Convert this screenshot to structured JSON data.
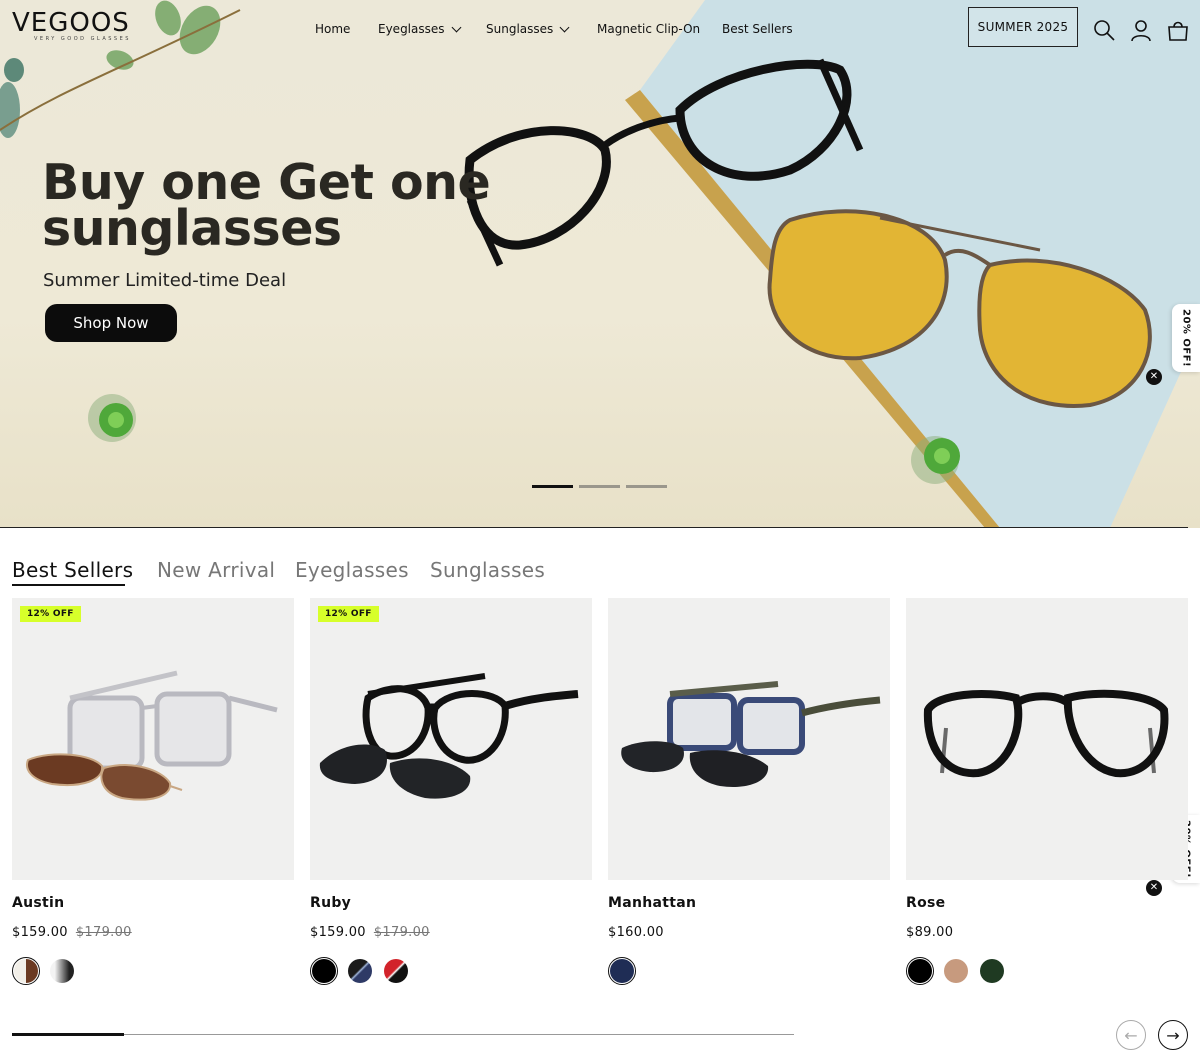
{
  "brand": {
    "name": "VEGOOS",
    "tagline": "VERY GOOD GLASSES"
  },
  "nav": [
    {
      "label": "Home",
      "has_dropdown": false
    },
    {
      "label": "Eyeglasses",
      "has_dropdown": true
    },
    {
      "label": "Sunglasses",
      "has_dropdown": true
    },
    {
      "label": "Magnetic Clip-On",
      "has_dropdown": false
    },
    {
      "label": "Best Sellers",
      "has_dropdown": false
    }
  ],
  "header": {
    "promo_button": "SUMMER 2025",
    "icons": [
      "search-icon",
      "account-icon",
      "cart-icon"
    ]
  },
  "hero": {
    "title": "Buy one Get one sunglasses",
    "subtitle": "Summer Limited-time Deal",
    "cta": "Shop Now",
    "slides_count": 3,
    "active_slide": 1
  },
  "side_offer": {
    "label": "20% OFF!",
    "close": "✕"
  },
  "tabs": [
    {
      "label": "Best Sellers",
      "active": true
    },
    {
      "label": "New Arrival",
      "active": false
    },
    {
      "label": "Eyeglasses",
      "active": false
    },
    {
      "label": "Sunglasses",
      "active": false
    }
  ],
  "products": [
    {
      "name": "Austin",
      "price": "$159.00",
      "old_price": "$179.00",
      "badge": "12% OFF",
      "swatches": [
        "#6b3a22",
        "#222222"
      ],
      "selected_swatch": 0
    },
    {
      "name": "Ruby",
      "price": "$159.00",
      "old_price": "$179.00",
      "badge": "12% OFF",
      "swatches": [
        "#000000",
        "#2e3a66",
        "#d2232a"
      ],
      "selected_swatch": 0
    },
    {
      "name": "Manhattan",
      "price": "$160.00",
      "old_price": "",
      "badge": "",
      "swatches": [
        "#1f2d55"
      ],
      "selected_swatch": 0
    },
    {
      "name": "Rose",
      "price": "$89.00",
      "old_price": "",
      "badge": "",
      "swatches": [
        "#000000",
        "#c79a7e",
        "#1f3a22"
      ],
      "selected_swatch": 0
    }
  ],
  "carousel": {
    "prev": "←",
    "next": "→"
  },
  "colors": {
    "accent_badge": "#d7ff2a",
    "button": "#0c0c0c",
    "text": "#111111"
  }
}
